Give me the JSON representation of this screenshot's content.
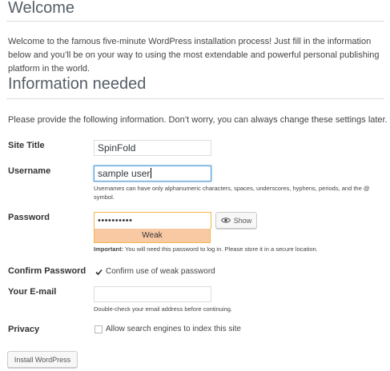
{
  "welcome": {
    "title": "Welcome",
    "intro": "Welcome to the famous five-minute WordPress installation process! Just fill in the information below and you’ll be on your way to using the most extendable and powerful personal publishing platform in the world."
  },
  "info": {
    "title": "Information needed",
    "intro": "Please provide the following information. Don’t worry, you can always change these settings later."
  },
  "form": {
    "site_title": {
      "label": "Site Title",
      "value": "SpinFold"
    },
    "username": {
      "label": "Username",
      "value": "sample user",
      "help": "Usernames can have only alphanumeric characters, spaces, underscores, hyphens, periods, and the @ symbol."
    },
    "password": {
      "label": "Password",
      "value": "••••••••••",
      "show_label": "Show",
      "show_icon": "eye-icon",
      "strength": "Weak",
      "strength_color": "#f9c9a4",
      "important_label": "Important:",
      "important_text": "You will need this password to log in. Please store it in a secure location."
    },
    "confirm_password": {
      "label": "Confirm Password",
      "checkbox_label": "Confirm use of weak password",
      "checked": true
    },
    "email": {
      "label": "Your E-mail",
      "value": "",
      "help": "Double-check your email address before continuing."
    },
    "privacy": {
      "label": "Privacy",
      "checkbox_label": "Allow search engines to index this site",
      "checked": false
    }
  },
  "submit": {
    "label": "Install WordPress"
  },
  "colors": {
    "focus_border": "#5b9dd9",
    "weak_border": "#f0b849",
    "heading": "#555d66"
  }
}
